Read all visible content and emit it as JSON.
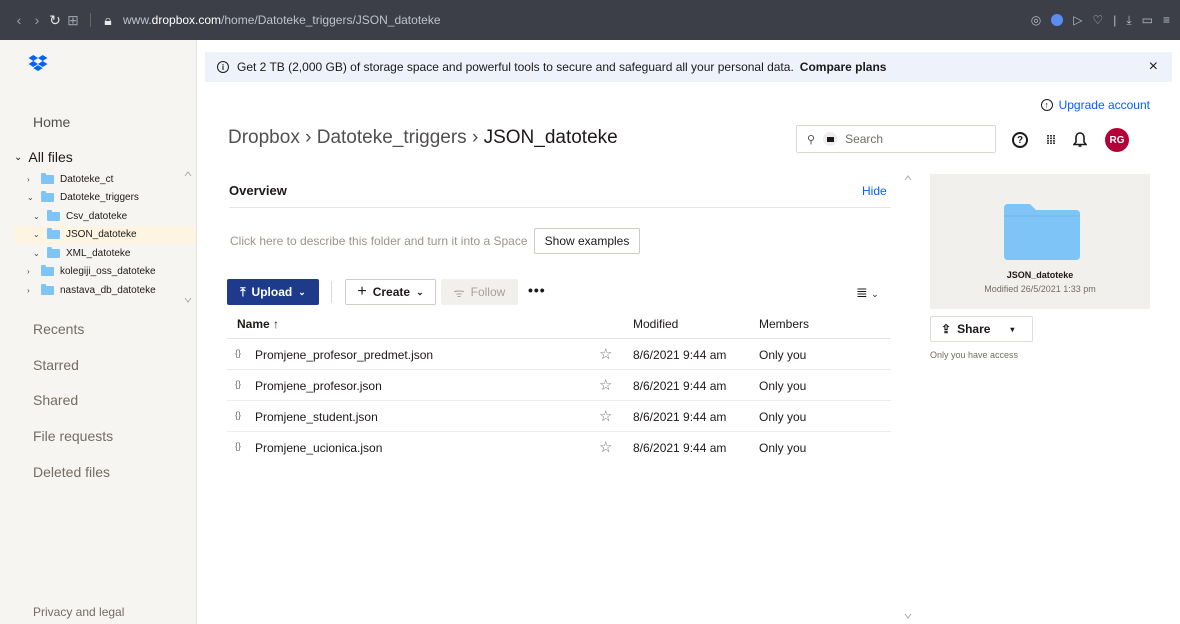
{
  "browser": {
    "url_prefix": "www.",
    "url_domain": "dropbox.com",
    "url_path": "/home/Datoteke_triggers/JSON_datoteke"
  },
  "sidebar": {
    "home": "Home",
    "all_files": "All files",
    "tree": [
      {
        "label": "Datoteke_ct",
        "expanded": false,
        "child": false
      },
      {
        "label": "Datoteke_triggers",
        "expanded": true,
        "child": false
      },
      {
        "label": "Csv_datoteke",
        "expanded": true,
        "child": true
      },
      {
        "label": "JSON_datoteke",
        "expanded": true,
        "child": true,
        "selected": true
      },
      {
        "label": "XML_datoteke",
        "expanded": true,
        "child": true
      },
      {
        "label": "kolegiji_oss_datoteke",
        "expanded": false,
        "child": false
      },
      {
        "label": "nastava_db_datoteke",
        "expanded": false,
        "child": false
      }
    ],
    "recents": "Recents",
    "starred": "Starred",
    "shared": "Shared",
    "file_requests": "File requests",
    "deleted_files": "Deleted files",
    "privacy": "Privacy and legal"
  },
  "banner": {
    "text": "Get 2 TB (2,000 GB) of storage space and powerful tools to secure and safeguard all your personal data.",
    "link": "Compare plans",
    "close": "×"
  },
  "header": {
    "upgrade": "Upgrade account",
    "crumb_root": "Dropbox",
    "crumb_mid": "Datoteke_triggers",
    "crumb_current": "JSON_datoteke",
    "search_placeholder": "Search",
    "avatar_initials": "RG"
  },
  "overview": {
    "title": "Overview",
    "hide": "Hide",
    "describe": "Click here to describe this folder and turn it into a Space",
    "show_examples": "Show examples"
  },
  "toolbar": {
    "upload": "Upload",
    "create": "Create",
    "follow": "Follow",
    "more": "•••"
  },
  "table": {
    "col_name": "Name",
    "col_modified": "Modified",
    "col_members": "Members",
    "rows": [
      {
        "name": "Promjene_profesor_predmet.json",
        "modified": "8/6/2021 9:44 am",
        "members": "Only you"
      },
      {
        "name": "Promjene_profesor.json",
        "modified": "8/6/2021 9:44 am",
        "members": "Only you"
      },
      {
        "name": "Promjene_student.json",
        "modified": "8/6/2021 9:44 am",
        "members": "Only you"
      },
      {
        "name": "Promjene_ucionica.json",
        "modified": "8/6/2021 9:44 am",
        "members": "Only you"
      }
    ]
  },
  "details": {
    "folder_name": "JSON_datoteke",
    "modified": "Modified 26/5/2021 1:33 pm",
    "share": "Share",
    "access": "Only you have access"
  },
  "colors": {
    "accent_blue": "#0061fe",
    "upload_bg": "#1e3a8a",
    "avatar_bg": "#b40039",
    "folder_blue": "#7fc4f7"
  }
}
